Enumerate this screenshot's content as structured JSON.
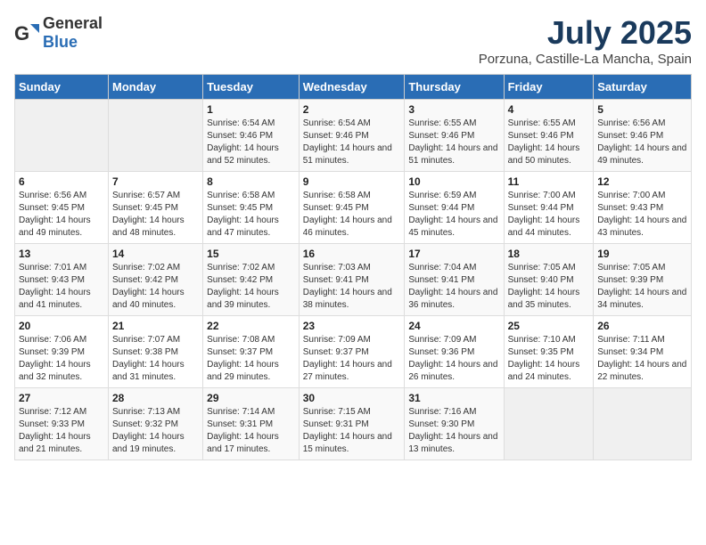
{
  "header": {
    "logo_general": "General",
    "logo_blue": "Blue",
    "title": "July 2025",
    "subtitle": "Porzuna, Castille-La Mancha, Spain"
  },
  "weekdays": [
    "Sunday",
    "Monday",
    "Tuesday",
    "Wednesday",
    "Thursday",
    "Friday",
    "Saturday"
  ],
  "weeks": [
    [
      {
        "day": "",
        "detail": ""
      },
      {
        "day": "",
        "detail": ""
      },
      {
        "day": "1",
        "detail": "Sunrise: 6:54 AM\nSunset: 9:46 PM\nDaylight: 14 hours and 52 minutes."
      },
      {
        "day": "2",
        "detail": "Sunrise: 6:54 AM\nSunset: 9:46 PM\nDaylight: 14 hours and 51 minutes."
      },
      {
        "day": "3",
        "detail": "Sunrise: 6:55 AM\nSunset: 9:46 PM\nDaylight: 14 hours and 51 minutes."
      },
      {
        "day": "4",
        "detail": "Sunrise: 6:55 AM\nSunset: 9:46 PM\nDaylight: 14 hours and 50 minutes."
      },
      {
        "day": "5",
        "detail": "Sunrise: 6:56 AM\nSunset: 9:46 PM\nDaylight: 14 hours and 49 minutes."
      }
    ],
    [
      {
        "day": "6",
        "detail": "Sunrise: 6:56 AM\nSunset: 9:45 PM\nDaylight: 14 hours and 49 minutes."
      },
      {
        "day": "7",
        "detail": "Sunrise: 6:57 AM\nSunset: 9:45 PM\nDaylight: 14 hours and 48 minutes."
      },
      {
        "day": "8",
        "detail": "Sunrise: 6:58 AM\nSunset: 9:45 PM\nDaylight: 14 hours and 47 minutes."
      },
      {
        "day": "9",
        "detail": "Sunrise: 6:58 AM\nSunset: 9:45 PM\nDaylight: 14 hours and 46 minutes."
      },
      {
        "day": "10",
        "detail": "Sunrise: 6:59 AM\nSunset: 9:44 PM\nDaylight: 14 hours and 45 minutes."
      },
      {
        "day": "11",
        "detail": "Sunrise: 7:00 AM\nSunset: 9:44 PM\nDaylight: 14 hours and 44 minutes."
      },
      {
        "day": "12",
        "detail": "Sunrise: 7:00 AM\nSunset: 9:43 PM\nDaylight: 14 hours and 43 minutes."
      }
    ],
    [
      {
        "day": "13",
        "detail": "Sunrise: 7:01 AM\nSunset: 9:43 PM\nDaylight: 14 hours and 41 minutes."
      },
      {
        "day": "14",
        "detail": "Sunrise: 7:02 AM\nSunset: 9:42 PM\nDaylight: 14 hours and 40 minutes."
      },
      {
        "day": "15",
        "detail": "Sunrise: 7:02 AM\nSunset: 9:42 PM\nDaylight: 14 hours and 39 minutes."
      },
      {
        "day": "16",
        "detail": "Sunrise: 7:03 AM\nSunset: 9:41 PM\nDaylight: 14 hours and 38 minutes."
      },
      {
        "day": "17",
        "detail": "Sunrise: 7:04 AM\nSunset: 9:41 PM\nDaylight: 14 hours and 36 minutes."
      },
      {
        "day": "18",
        "detail": "Sunrise: 7:05 AM\nSunset: 9:40 PM\nDaylight: 14 hours and 35 minutes."
      },
      {
        "day": "19",
        "detail": "Sunrise: 7:05 AM\nSunset: 9:39 PM\nDaylight: 14 hours and 34 minutes."
      }
    ],
    [
      {
        "day": "20",
        "detail": "Sunrise: 7:06 AM\nSunset: 9:39 PM\nDaylight: 14 hours and 32 minutes."
      },
      {
        "day": "21",
        "detail": "Sunrise: 7:07 AM\nSunset: 9:38 PM\nDaylight: 14 hours and 31 minutes."
      },
      {
        "day": "22",
        "detail": "Sunrise: 7:08 AM\nSunset: 9:37 PM\nDaylight: 14 hours and 29 minutes."
      },
      {
        "day": "23",
        "detail": "Sunrise: 7:09 AM\nSunset: 9:37 PM\nDaylight: 14 hours and 27 minutes."
      },
      {
        "day": "24",
        "detail": "Sunrise: 7:09 AM\nSunset: 9:36 PM\nDaylight: 14 hours and 26 minutes."
      },
      {
        "day": "25",
        "detail": "Sunrise: 7:10 AM\nSunset: 9:35 PM\nDaylight: 14 hours and 24 minutes."
      },
      {
        "day": "26",
        "detail": "Sunrise: 7:11 AM\nSunset: 9:34 PM\nDaylight: 14 hours and 22 minutes."
      }
    ],
    [
      {
        "day": "27",
        "detail": "Sunrise: 7:12 AM\nSunset: 9:33 PM\nDaylight: 14 hours and 21 minutes."
      },
      {
        "day": "28",
        "detail": "Sunrise: 7:13 AM\nSunset: 9:32 PM\nDaylight: 14 hours and 19 minutes."
      },
      {
        "day": "29",
        "detail": "Sunrise: 7:14 AM\nSunset: 9:31 PM\nDaylight: 14 hours and 17 minutes."
      },
      {
        "day": "30",
        "detail": "Sunrise: 7:15 AM\nSunset: 9:31 PM\nDaylight: 14 hours and 15 minutes."
      },
      {
        "day": "31",
        "detail": "Sunrise: 7:16 AM\nSunset: 9:30 PM\nDaylight: 14 hours and 13 minutes."
      },
      {
        "day": "",
        "detail": ""
      },
      {
        "day": "",
        "detail": ""
      }
    ]
  ]
}
